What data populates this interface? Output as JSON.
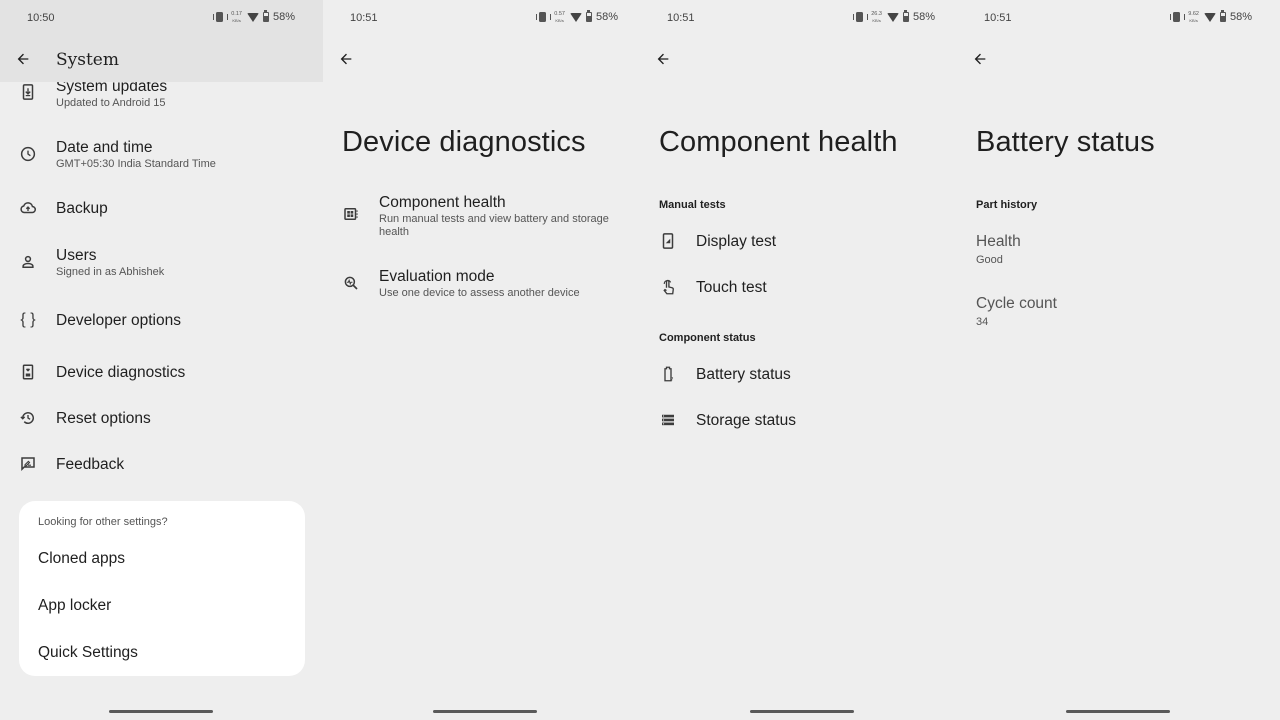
{
  "panels": [
    {
      "status": {
        "time": "10:50",
        "net_speed": "0.17",
        "net_unit": "KB/s",
        "battery": "58%"
      },
      "title": "System",
      "items": [
        {
          "icon": "system-update-icon",
          "title": "System updates",
          "subtitle": "Updated to Android 15"
        },
        {
          "icon": "clock-icon",
          "title": "Date and time",
          "subtitle": "GMT+05:30 India Standard Time"
        },
        {
          "icon": "cloud-upload-icon",
          "title": "Backup",
          "subtitle": ""
        },
        {
          "icon": "person-icon",
          "title": "Users",
          "subtitle": "Signed in as Abhishek"
        },
        {
          "icon": "braces-icon",
          "title": "Developer options",
          "subtitle": ""
        },
        {
          "icon": "device-diagnostics-icon",
          "title": "Device diagnostics",
          "subtitle": ""
        },
        {
          "icon": "history-icon",
          "title": "Reset options",
          "subtitle": ""
        },
        {
          "icon": "feedback-icon",
          "title": "Feedback",
          "subtitle": ""
        }
      ],
      "other_settings": {
        "label": "Looking for other settings?",
        "options": [
          "Cloned apps",
          "App locker",
          "Quick Settings"
        ]
      }
    },
    {
      "status": {
        "time": "10:51",
        "net_speed": "0.57",
        "net_unit": "KB/s",
        "battery": "58%"
      },
      "title": "Device diagnostics",
      "items": [
        {
          "icon": "component-health-icon",
          "title": "Component health",
          "subtitle": "Run manual tests and view battery and storage health"
        },
        {
          "icon": "evaluation-mode-icon",
          "title": "Evaluation mode",
          "subtitle": "Use one device to assess another device"
        }
      ]
    },
    {
      "status": {
        "time": "10:51",
        "net_speed": "26.3",
        "net_unit": "KB/s",
        "battery": "58%"
      },
      "title": "Component health",
      "sections": [
        {
          "label": "Manual tests",
          "items": [
            {
              "icon": "display-test-icon",
              "title": "Display test"
            },
            {
              "icon": "touch-test-icon",
              "title": "Touch test"
            }
          ]
        },
        {
          "label": "Component status",
          "items": [
            {
              "icon": "battery-status-icon",
              "title": "Battery status"
            },
            {
              "icon": "storage-status-icon",
              "title": "Storage status"
            }
          ]
        }
      ]
    },
    {
      "status": {
        "time": "10:51",
        "net_speed": "9.62",
        "net_unit": "KB/s",
        "battery": "58%"
      },
      "title": "Battery status",
      "section_label": "Part history",
      "fields": [
        {
          "label": "Health",
          "value": "Good"
        },
        {
          "label": "Cycle count",
          "value": "34"
        }
      ]
    }
  ]
}
